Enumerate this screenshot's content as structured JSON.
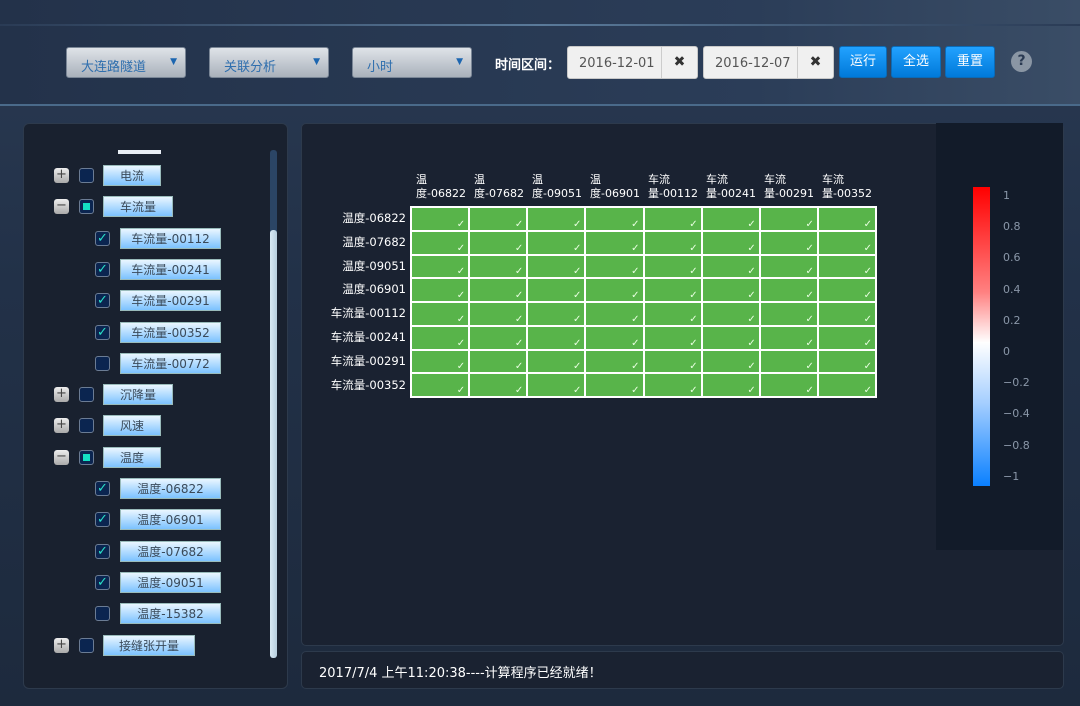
{
  "toolbar": {
    "site": "大连路隧道",
    "analysis": "关联分析",
    "granularity": "小时",
    "time_label": "时间区间：",
    "start_date": "2016-12-01",
    "end_date": "2016-12-07",
    "clear_icon": "✖",
    "run": "运行",
    "select_all": "全选",
    "reset": "重置",
    "help": "?"
  },
  "tree": [
    {
      "label": "电流",
      "expanded": false,
      "state": "unchecked"
    },
    {
      "label": "车流量",
      "expanded": true,
      "state": "partial",
      "children": [
        {
          "label": "车流量-00112",
          "checked": true
        },
        {
          "label": "车流量-00241",
          "checked": true
        },
        {
          "label": "车流量-00291",
          "checked": true
        },
        {
          "label": "车流量-00352",
          "checked": true
        },
        {
          "label": "车流量-00772",
          "checked": false
        }
      ]
    },
    {
      "label": "沉降量",
      "expanded": false,
      "state": "unchecked"
    },
    {
      "label": "风速",
      "expanded": false,
      "state": "unchecked"
    },
    {
      "label": "温度",
      "expanded": true,
      "state": "partial",
      "children": [
        {
          "label": "温度-06822",
          "checked": true
        },
        {
          "label": "温度-06901",
          "checked": true
        },
        {
          "label": "温度-07682",
          "checked": true
        },
        {
          "label": "温度-09051",
          "checked": true
        },
        {
          "label": "温度-15382",
          "checked": false
        }
      ]
    },
    {
      "label": "接缝张开量",
      "expanded": false,
      "state": "unchecked"
    }
  ],
  "chart_data": {
    "type": "heatmap",
    "columns": [
      [
        "温",
        "度-06822"
      ],
      [
        "温",
        "度-07682"
      ],
      [
        "温",
        "度-09051"
      ],
      [
        "温",
        "度-06901"
      ],
      [
        "车流",
        "量-00112"
      ],
      [
        "车流",
        "量-00241"
      ],
      [
        "车流",
        "量-00291"
      ],
      [
        "车流",
        "量-00352"
      ]
    ],
    "rows": [
      "温度-06822",
      "温度-07682",
      "温度-09051",
      "温度-06901",
      "车流量-00112",
      "车流量-00241",
      "车流量-00291",
      "车流量-00352"
    ],
    "cell_mark": "✓",
    "cell_color": "#58b44a",
    "colorbar": {
      "range": [
        -1,
        1
      ],
      "ticks": [
        "1",
        "0.8",
        "0.6",
        "0.4",
        "0.2",
        "0",
        "−0.2",
        "−0.4",
        "−0.8",
        "−1"
      ],
      "colors": [
        "#ff0000",
        "#ffffff",
        "#0a80ff"
      ]
    }
  },
  "status": "2017/7/4 上午11:20:38----计算程序已经就绪！"
}
